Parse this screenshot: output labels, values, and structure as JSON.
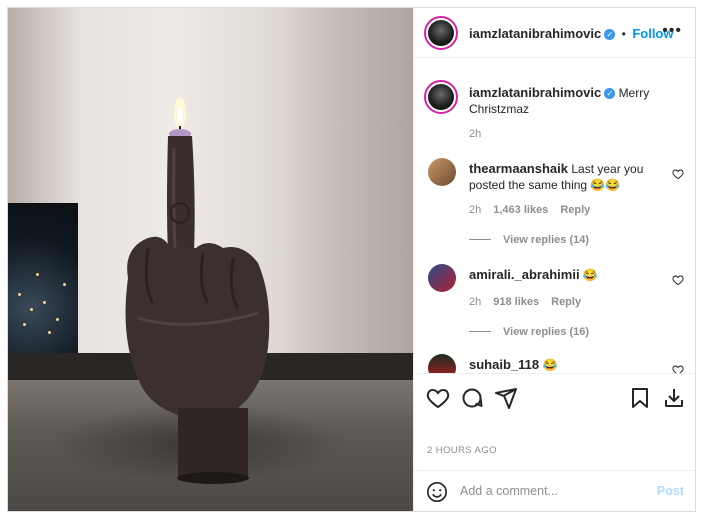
{
  "post": {
    "author": "iamzlatanibrahimovic",
    "verified_icon": "verified-badge-icon",
    "separator": "•",
    "follow_label": "Follow",
    "more_icon": "more-options-icon",
    "caption": "Merry Christzmaz",
    "caption_time": "2h",
    "time_ago": "2 HOURS AGO"
  },
  "photo": {
    "description_icon": "middle-finger-candle"
  },
  "comments": [
    {
      "username": "thearmaanshaik",
      "text": "Last year you posted the same thing 😂😂",
      "time": "2h",
      "likes": "1,463 likes",
      "reply": "Reply",
      "view_replies": "View replies (14)"
    },
    {
      "username": "amirali._abrahimii",
      "text": "😂",
      "time": "2h",
      "likes": "918 likes",
      "reply": "Reply",
      "view_replies": "View replies (16)"
    },
    {
      "username": "suhaib_118",
      "text": "😂"
    }
  ],
  "add_comment": {
    "placeholder": "Add a comment...",
    "post_label": "Post"
  },
  "icons": {
    "like": "heart-icon",
    "comment": "comment-icon",
    "share": "share-icon",
    "save": "bookmark-icon",
    "emoji": "emoji-icon"
  },
  "colors": {
    "accent": "#0095f6",
    "post_disabled": "#b3dbff",
    "muted": "#8e8e8e",
    "text": "#262626"
  }
}
